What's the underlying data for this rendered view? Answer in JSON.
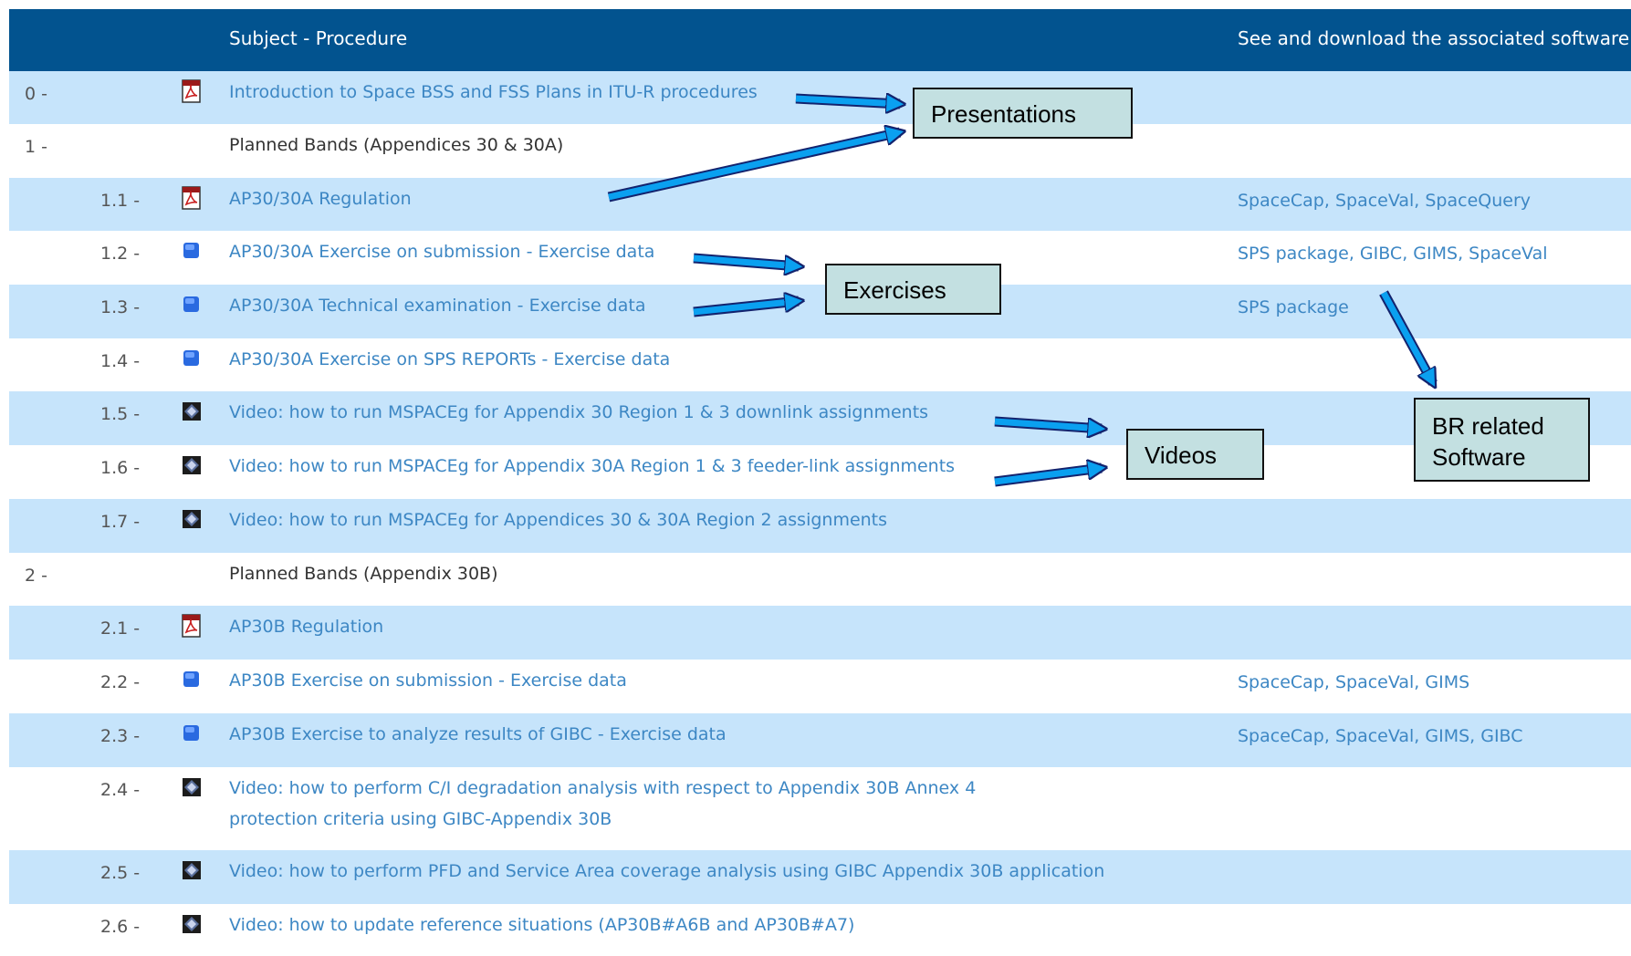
{
  "header": {
    "subject_procedure": "Subject - Procedure",
    "software": "See and download the associated software"
  },
  "rows": [
    {
      "num1": "0 -",
      "num2": "",
      "icon": "pdf-icon",
      "subject": "Introduction to Space BSS and FSS Plans in ITU-R procedures",
      "subject_link": true,
      "software": ""
    },
    {
      "num1": "1 -",
      "num2": "",
      "icon": "",
      "subject": "Planned Bands (Appendices 30 & 30A)",
      "subject_link": false,
      "software": ""
    },
    {
      "num1": "",
      "num2": "1.1 -",
      "icon": "pdf-icon",
      "subject": "AP30/30A Regulation",
      "subject_link": true,
      "software": "SpaceCap, SpaceVal, SpaceQuery"
    },
    {
      "num1": "",
      "num2": "1.2 -",
      "icon": "exercise-icon",
      "subject": "AP30/30A Exercise on submission - Exercise data",
      "subject_link": true,
      "software": "SPS package, GIBC, GIMS, SpaceVal"
    },
    {
      "num1": "",
      "num2": "1.3 -",
      "icon": "exercise-icon",
      "subject": "AP30/30A Technical examination - Exercise data",
      "subject_link": true,
      "software": "SPS package"
    },
    {
      "num1": "",
      "num2": "1.4 -",
      "icon": "exercise-icon",
      "subject": "AP30/30A Exercise on SPS REPORTs - Exercise data",
      "subject_link": true,
      "software": ""
    },
    {
      "num1": "",
      "num2": "1.5 -",
      "icon": "video-icon",
      "subject": "Video: how to run MSPACEg for Appendix 30 Region 1 & 3 downlink assignments",
      "subject_link": true,
      "software": ""
    },
    {
      "num1": "",
      "num2": "1.6 -",
      "icon": "video-icon",
      "subject": "Video: how to run MSPACEg for Appendix 30A Region 1 & 3 feeder-link assignments",
      "subject_link": true,
      "software": ""
    },
    {
      "num1": "",
      "num2": "1.7 -",
      "icon": "video-icon",
      "subject": "Video: how to run MSPACEg for Appendices 30 & 30A Region 2 assignments",
      "subject_link": true,
      "software": ""
    },
    {
      "num1": "2 -",
      "num2": "",
      "icon": "",
      "subject": "Planned Bands (Appendix 30B)",
      "subject_link": false,
      "software": ""
    },
    {
      "num1": "",
      "num2": "2.1 -",
      "icon": "pdf-icon",
      "subject": "AP30B Regulation",
      "subject_link": true,
      "software": ""
    },
    {
      "num1": "",
      "num2": "2.2 -",
      "icon": "exercise-icon",
      "subject": "AP30B Exercise on submission - Exercise data",
      "subject_link": true,
      "software": "SpaceCap, SpaceVal,  GIMS"
    },
    {
      "num1": "",
      "num2": "2.3 -",
      "icon": "exercise-icon",
      "subject": "AP30B Exercise to analyze results of GIBC - Exercise data",
      "subject_link": true,
      "software": "SpaceCap, SpaceVal,  GIMS, GIBC"
    },
    {
      "num1": "",
      "num2": "2.4 -",
      "icon": "video-icon",
      "subject": "Video: how to perform C/I degradation analysis with respect to Appendix 30B Annex 4 protection criteria using GIBC-Appendix 30B",
      "subject_link": true,
      "software": ""
    },
    {
      "num1": "",
      "num2": "2.5 -",
      "icon": "video-icon",
      "subject": "Video: how to perform PFD and Service Area coverage analysis using GIBC Appendix 30B application",
      "subject_link": true,
      "software": ""
    },
    {
      "num1": "",
      "num2": "2.6 -",
      "icon": "video-icon",
      "subject": "Video: how to update reference situations (AP30B#A6B and AP30B#A7)",
      "subject_link": true,
      "software": ""
    }
  ],
  "callouts": {
    "presentations": "Presentations",
    "exercises": "Exercises",
    "videos": "Videos",
    "software_line1": "BR related",
    "software_line2": "Software"
  },
  "colors": {
    "header_bg": "#02538f",
    "row_alt_bg": "#c6e4fb",
    "link": "#3d87c4",
    "callout_bg": "#c3e0e1",
    "arrow_fill": "#0aa0f0"
  }
}
